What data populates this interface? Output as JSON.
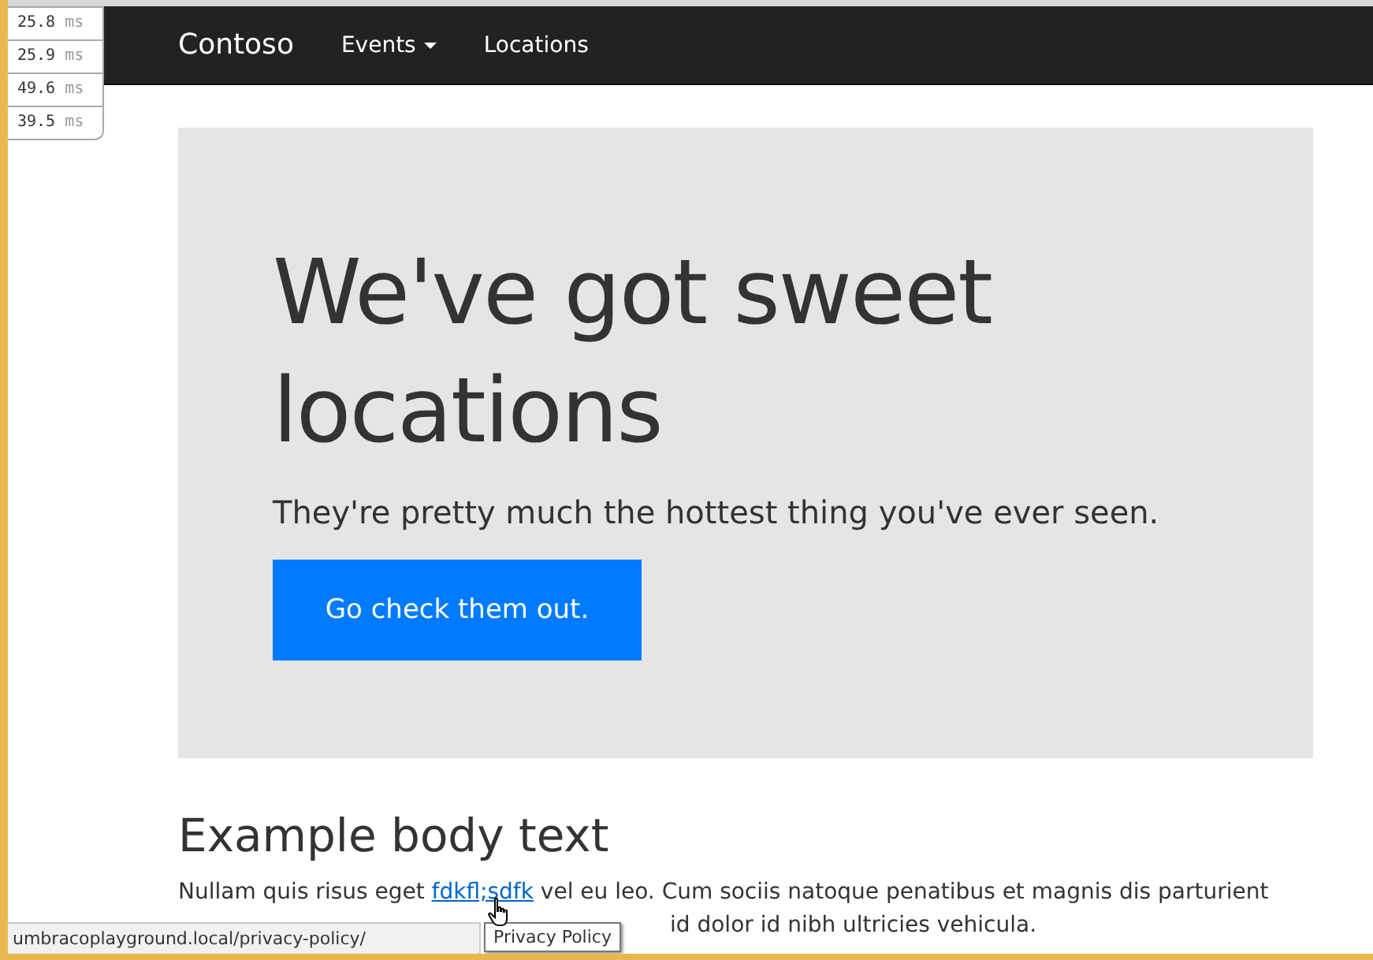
{
  "timings": [
    {
      "value": "25.8",
      "unit": "ms"
    },
    {
      "value": "25.9",
      "unit": "ms"
    },
    {
      "value": "49.6",
      "unit": "ms"
    },
    {
      "value": "39.5",
      "unit": "ms"
    }
  ],
  "navbar": {
    "brand": "Contoso",
    "items": [
      {
        "label": "Events",
        "dropdown": true
      },
      {
        "label": "Locations",
        "dropdown": false
      }
    ]
  },
  "hero": {
    "title": "We've got sweet locations",
    "lead": "They're pretty much the hottest thing you've ever seen.",
    "button": "Go check them out."
  },
  "body": {
    "heading": "Example body text",
    "before_link": "Nullam quis risus eget ",
    "link": "fdkfl;sdfk",
    "after_link": " vel eu leo. Cum sociis natoque penatibus et magnis dis parturient",
    "second_line_visible": "id dolor id nibh ultricies vehicula."
  },
  "status_bar": {
    "url": "umbracoplayground.local/privacy-policy/"
  },
  "tooltip": {
    "text": "Privacy Policy"
  }
}
